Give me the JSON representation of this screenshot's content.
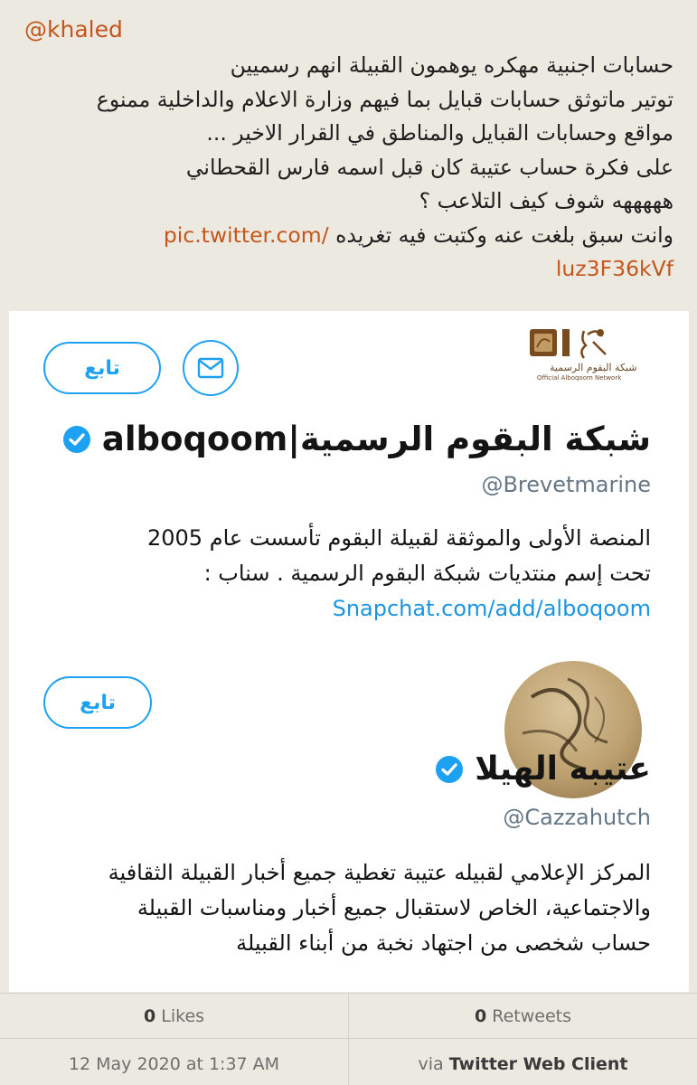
{
  "tweet": {
    "handle": "@khaled",
    "lines": [
      "حسابات اجنبية مهكره يوهمون القبيلة انهم رسميين",
      "توتير ماتوثق حسابات قبايل بما فيهم وزارة الاعلام والداخلية ممنوع",
      "مواقع وحسابات القبايل والمناطق في القرار الاخير ...",
      "على فكرة حساب عتيبة كان قبل اسمه فارس القحطاني",
      "هههههه شوف كيف التلاعب ؟"
    ],
    "last_line_text": "وانت سبق بلغت عنه وكتبت فيه تغريده",
    "link_part1": "pic.twitter.com/",
    "link_part2": "luz3F36kVf"
  },
  "card": {
    "profiles": [
      {
        "follow_label": "تابع",
        "logo_text_ar": "شبكة البقوم الرسمية",
        "logo_text_en": "Official Alboqoom Network",
        "name": "شبكة البقوم الرسمية|alboqoom",
        "username": "@Brevetmarine",
        "bio_lines": [
          "المنصة الأولى والموثقة لقبيلة البقوم تأسست عام 2005",
          "تحت إسم  منتديات شبكة البقوم الرسمية . سناب :"
        ],
        "bio_link": "Snapchat.com/add/alboqoom"
      },
      {
        "follow_label": "تابع",
        "name": "عتيبه الهيلا",
        "username": "@Cazzahutch",
        "bio_lines": [
          "المركز الإعلامي لقبيله عتيبة تغطية جميع أخبار القبيلة الثقافية",
          "والاجتماعية، الخاص لاستقبال جميع أخبار ومناسبات القبيلة",
          "حساب شخصى من اجتهاد نخبة من أبناء القبيلة"
        ]
      }
    ]
  },
  "stats": {
    "likes_count": "0",
    "likes_label": "Likes",
    "retweets_count": "0",
    "retweets_label": "Retweets",
    "timestamp": "12 May 2020 at 1:37 AM",
    "via_prefix": "via",
    "client": "Twitter Web Client"
  },
  "colors": {
    "background": "#ece9e1",
    "accent": "#c4561b",
    "twitter_blue": "#1da1f2",
    "link_blue": "#1b95e0"
  }
}
